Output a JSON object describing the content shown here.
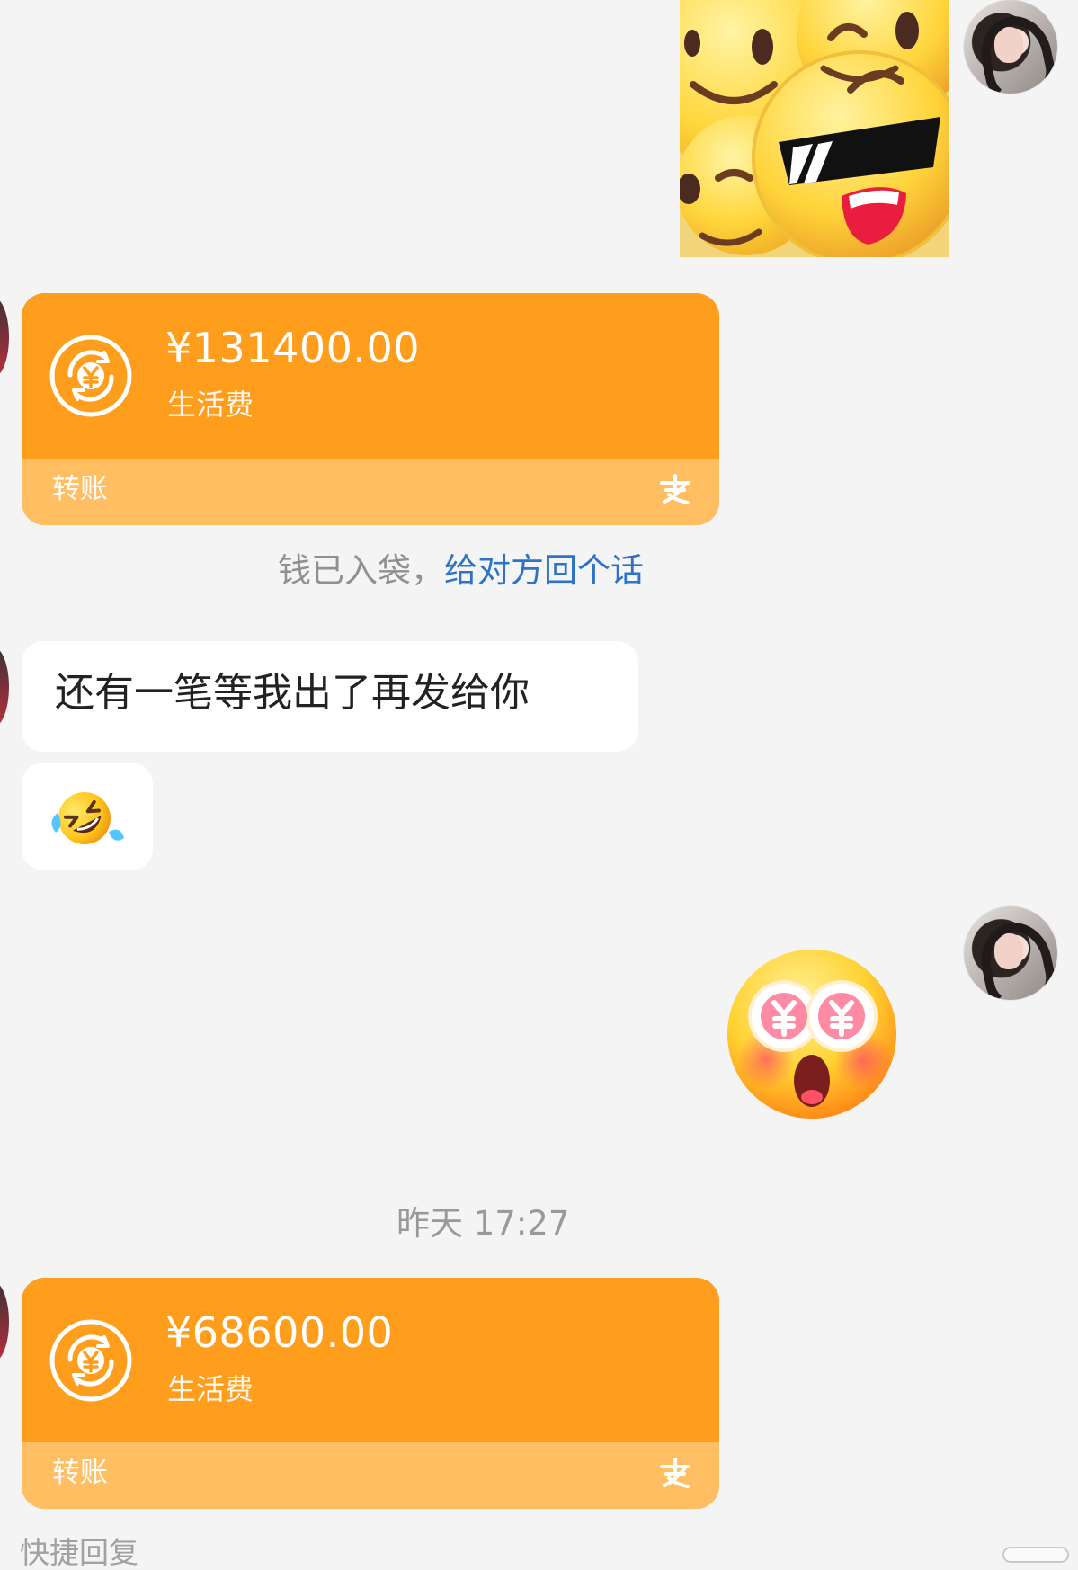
{
  "messages": {
    "transfer_1": {
      "amount": "¥131400.00",
      "memo": "生活费",
      "type_label": "转账",
      "icon": "transfer-yuan-icon",
      "brand_icon": "alipay-icon"
    },
    "received_notice": {
      "text": "钱已入袋，",
      "action": "给对方回个话"
    },
    "text_message": "还有一笔等我出了再发给你",
    "emoji_message_icon": "rolling-laughing-emoji",
    "reply_sticker_icon": "money-eyes-shocked-emoji",
    "timestamp": "昨天 17:27",
    "transfer_2": {
      "amount": "¥68600.00",
      "memo": "生活费",
      "type_label": "转账",
      "icon": "transfer-yuan-icon",
      "brand_icon": "alipay-icon"
    }
  },
  "bottom": {
    "quick_reply": "快捷回复"
  },
  "colors": {
    "chat_background": "#f4f4f4",
    "transfer_orange": "#ff9d1c",
    "transfer_footer_orange": "#ffbe62",
    "link_blue": "#2e73c8",
    "system_gray": "#909090"
  }
}
